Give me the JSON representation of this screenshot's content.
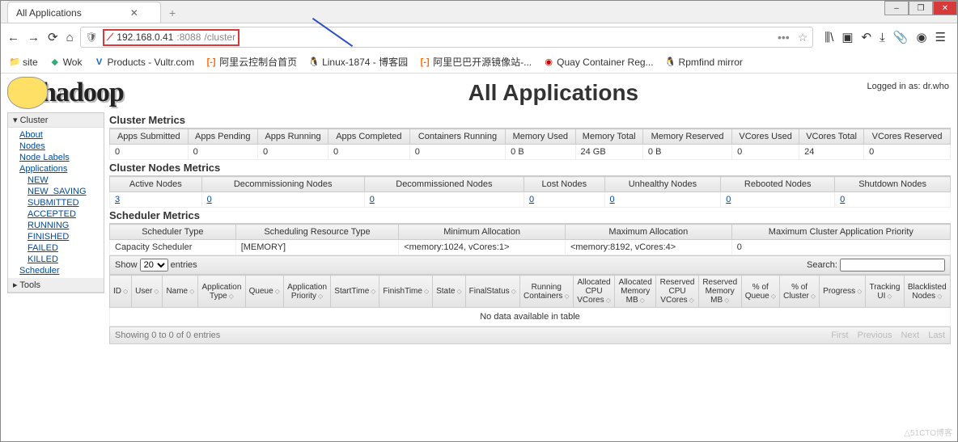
{
  "browser": {
    "tab_title": "All Applications",
    "url_ip": "192.168.0.41",
    "url_port": ":8088",
    "url_path": "/cluster",
    "win_min": "–",
    "win_max": "❐",
    "win_close": "✕"
  },
  "bookmarks": [
    {
      "label": "site",
      "icon": "📁"
    },
    {
      "label": "Wok",
      "icon": "🔵"
    },
    {
      "label": "Products - Vultr.com",
      "icon": "V"
    },
    {
      "label": "阿里云控制台首页",
      "icon": "[-]"
    },
    {
      "label": "Linux-1874 - 博客园",
      "icon": "🐧"
    },
    {
      "label": "阿里巴巴开源镜像站-...",
      "icon": "[-]"
    },
    {
      "label": "Quay Container Reg...",
      "icon": "🔴"
    },
    {
      "label": "Rpmfind mirror",
      "icon": "🐧"
    }
  ],
  "login_text": "Logged in as: dr.who",
  "logo_text": "hadoop",
  "page_title": "All Applications",
  "sidebar": {
    "cluster_head": "▾ Cluster",
    "tools_head": "▸ Tools",
    "cluster_links": [
      "About",
      "Nodes",
      "Node Labels",
      "Applications"
    ],
    "app_states": [
      "NEW",
      "NEW_SAVING",
      "SUBMITTED",
      "ACCEPTED",
      "RUNNING",
      "FINISHED",
      "FAILED",
      "KILLED"
    ],
    "scheduler_link": "Scheduler"
  },
  "cluster_metrics": {
    "title": "Cluster Metrics",
    "headers": [
      "Apps Submitted",
      "Apps Pending",
      "Apps Running",
      "Apps Completed",
      "Containers Running",
      "Memory Used",
      "Memory Total",
      "Memory Reserved",
      "VCores Used",
      "VCores Total",
      "VCores Reserved"
    ],
    "values": [
      "0",
      "0",
      "0",
      "0",
      "0",
      "0 B",
      "24 GB",
      "0 B",
      "0",
      "24",
      "0"
    ]
  },
  "nodes_metrics": {
    "title": "Cluster Nodes Metrics",
    "headers": [
      "Active Nodes",
      "Decommissioning Nodes",
      "Decommissioned Nodes",
      "Lost Nodes",
      "Unhealthy Nodes",
      "Rebooted Nodes",
      "Shutdown Nodes"
    ],
    "values": [
      "3",
      "0",
      "0",
      "0",
      "0",
      "0",
      "0"
    ]
  },
  "scheduler_metrics": {
    "title": "Scheduler Metrics",
    "headers": [
      "Scheduler Type",
      "Scheduling Resource Type",
      "Minimum Allocation",
      "Maximum Allocation",
      "Maximum Cluster Application Priority"
    ],
    "values": [
      "Capacity Scheduler",
      "[MEMORY]",
      "<memory:1024, vCores:1>",
      "<memory:8192, vCores:4>",
      "0"
    ]
  },
  "datatable": {
    "show_prefix": "Show",
    "show_count": "20",
    "show_suffix": "entries",
    "search_label": "Search:",
    "headers": [
      "ID",
      "User",
      "Name",
      "Application Type",
      "Queue",
      "Application Priority",
      "StartTime",
      "FinishTime",
      "State",
      "FinalStatus",
      "Running Containers",
      "Allocated CPU VCores",
      "Allocated Memory MB",
      "Reserved CPU VCores",
      "Reserved Memory MB",
      "% of Queue",
      "% of Cluster",
      "Progress",
      "Tracking UI",
      "Blacklisted Nodes"
    ],
    "no_data": "No data available in table",
    "info": "Showing 0 to 0 of 0 entries",
    "pag": [
      "First",
      "Previous",
      "Next",
      "Last"
    ]
  },
  "watermark": "△51CTO博客"
}
